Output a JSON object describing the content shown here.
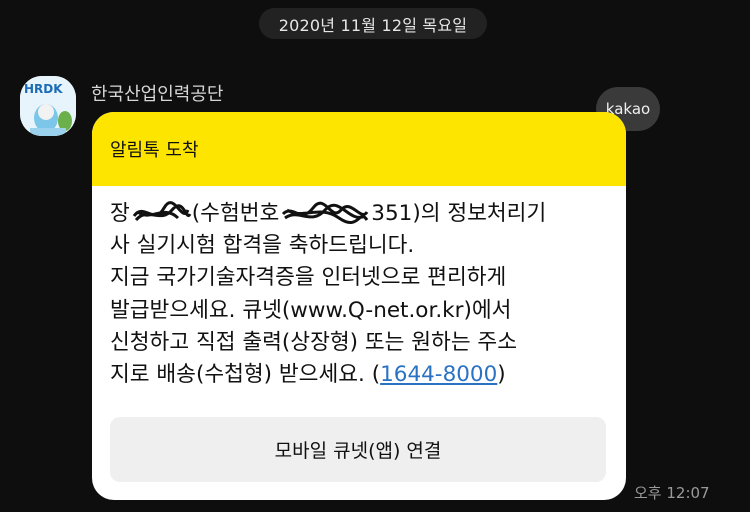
{
  "date_divider": "2020년 11월 12일 목요일",
  "message": {
    "sender_name": "한국산업인력공단",
    "avatar_text": "HRDK",
    "badge": "kakao",
    "header_title": "알림톡 도착",
    "body_lines": {
      "l1_prefix": "장",
      "l1_mid": "(수험번호",
      "l1_suffix": "351)의 정보처리기",
      "l2": "사 실기시험 합격을 축하드립니다.",
      "l3": "지금 국가기술자격증을 인터넷으로 편리하게",
      "l4": "발급받으세요. 큐넷(www.Q-net.or.kr)에서",
      "l5": "신청하고 직접 출력(상장형) 또는 원하는 주소",
      "l6_prefix": "지로 배송(수첩형) 받으세요. (",
      "l6_phone": "1644-8000",
      "l6_suffix": ")"
    },
    "button_label": "모바일 큐넷(앱) 연결",
    "time": "오후 12:07"
  },
  "colors": {
    "background": "#0e0e0e",
    "header_yellow": "#fee500",
    "bubble": "#ffffff",
    "link": "#2a72c4"
  }
}
